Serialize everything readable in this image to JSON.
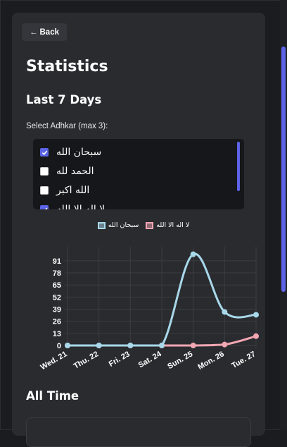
{
  "nav": {
    "back_label": "Back"
  },
  "page": {
    "title": "Statistics",
    "section_week": "Last 7 Days",
    "section_alltime": "All Time"
  },
  "adhkar_select": {
    "label": "Select Adhkar (max 3):",
    "items": [
      {
        "label": "سبحان الله",
        "checked": true
      },
      {
        "label": "الحمد لله",
        "checked": false
      },
      {
        "label": "الله اكبر",
        "checked": false
      },
      {
        "label": "لا اله الا الله",
        "checked": true
      }
    ]
  },
  "colors": {
    "accent": "#5b63e6",
    "series1": "#a8d8ea",
    "series2": "#f2a7b3"
  },
  "chart_data": {
    "type": "line",
    "categories": [
      "Wed. 21",
      "Thu. 22",
      "Fri. 23",
      "Sat. 24",
      "Sun. 25",
      "Mon. 26",
      "Tue. 27"
    ],
    "yticks": [
      0,
      13,
      26,
      39,
      52,
      65,
      78,
      91
    ],
    "ylim": [
      0,
      100
    ],
    "grid": true,
    "legend_position": "top",
    "series": [
      {
        "name": "سبحان الله",
        "values": [
          0,
          0,
          0,
          0,
          98,
          36,
          33
        ]
      },
      {
        "name": "لا اله الا الله",
        "values": [
          0,
          0,
          0,
          0,
          0,
          1,
          10
        ]
      }
    ]
  }
}
